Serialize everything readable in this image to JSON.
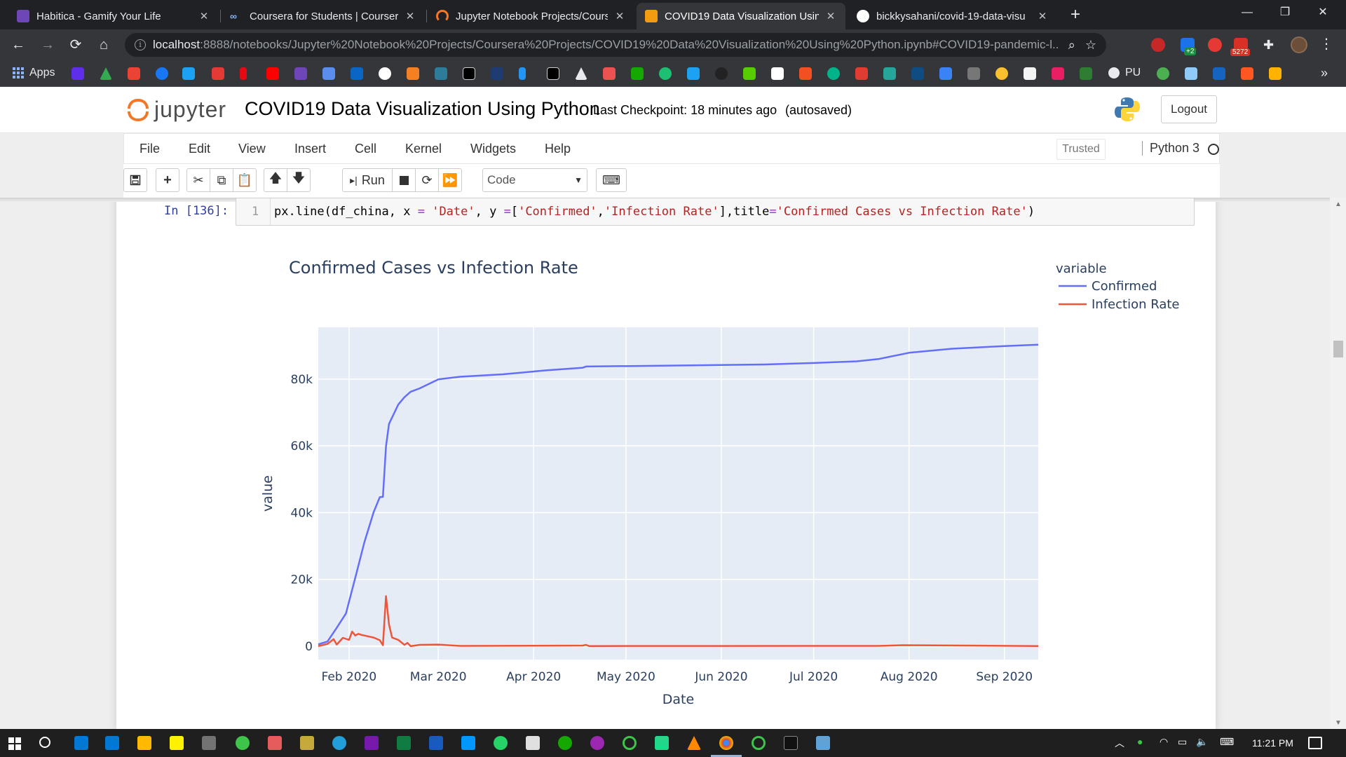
{
  "browser": {
    "tabs": [
      {
        "title": "Habitica - Gamify Your Life",
        "color": "#6f46b8"
      },
      {
        "title": "Coursera for Students | Coursera",
        "color": "#8ab4f8"
      },
      {
        "title": "Jupyter Notebook Projects/Cours",
        "color": "#f37726"
      },
      {
        "title": "COVID19 Data Visualization Usin",
        "color": "#f39c12"
      },
      {
        "title": "bickkysahani/covid-19-data-visu",
        "color": "#ffffff"
      }
    ],
    "active_tab_index": 3,
    "tab_close_glyph": "✕",
    "new_tab_glyph": "+",
    "window_controls": [
      "—",
      "❐",
      "✕"
    ],
    "url_host": "localhost",
    "url_rest": ":8888/notebooks/Jupyter%20Notebook%20Projects/Coursera%20Projects/COVID19%20Data%20Visualization%20Using%20Python.ipynb#COVID19-pandemic-l...",
    "extension_badges": {
      "plus": "+2",
      "count": "5272"
    },
    "bookmarks": {
      "apps_label": "Apps",
      "pu_label": "PU",
      "more": "»"
    }
  },
  "jupyter": {
    "logo_text": "jupyter",
    "notebook_title": "COVID19 Data Visualization Using Python",
    "checkpoint": "Last Checkpoint: 18 minutes ago",
    "autosave": "(autosaved)",
    "logout": "Logout",
    "menu": [
      "File",
      "Edit",
      "View",
      "Insert",
      "Cell",
      "Kernel",
      "Widgets",
      "Help"
    ],
    "trusted": "Trusted",
    "kernel": "Python 3",
    "toolbar": {
      "run_label": "Run",
      "cell_type": "Code"
    }
  },
  "cell": {
    "prompt": "In [136]:",
    "line_number": "1",
    "code_parts": [
      {
        "t": "px.line(df_china, x ",
        "c": "plain"
      },
      {
        "t": "=",
        "c": "op"
      },
      {
        "t": " ",
        "c": "plain"
      },
      {
        "t": "'Date'",
        "c": "str"
      },
      {
        "t": ", y ",
        "c": "plain"
      },
      {
        "t": "=",
        "c": "op"
      },
      {
        "t": "[",
        "c": "plain"
      },
      {
        "t": "'Confirmed'",
        "c": "str"
      },
      {
        "t": ",",
        "c": "plain"
      },
      {
        "t": "'Infection Rate'",
        "c": "str"
      },
      {
        "t": "],title",
        "c": "plain"
      },
      {
        "t": "=",
        "c": "op"
      },
      {
        "t": "'Confirmed Cases vs Infection Rate'",
        "c": "str"
      },
      {
        "t": ")",
        "c": "plain"
      }
    ]
  },
  "chart_data": {
    "type": "line",
    "title": "Confirmed Cases vs Infection Rate",
    "xlabel": "Date",
    "ylabel": "value",
    "x_tick_labels": [
      "Feb 2020",
      "Mar 2020",
      "Apr 2020",
      "May 2020",
      "Jun 2020",
      "Jul 2020",
      "Aug 2020",
      "Sep 2020"
    ],
    "x_tick_dates": [
      "2020-02-01",
      "2020-03-01",
      "2020-04-01",
      "2020-05-01",
      "2020-06-01",
      "2020-07-01",
      "2020-08-01",
      "2020-09-01"
    ],
    "xlim": [
      "2020-01-22",
      "2020-09-12"
    ],
    "y_ticks": [
      0,
      20000,
      40000,
      60000,
      80000
    ],
    "y_tick_labels": [
      "0",
      "20k",
      "40k",
      "60k",
      "80k"
    ],
    "ylim": [
      -4000,
      95500
    ],
    "grid": true,
    "legend_title": "variable",
    "legend_position": "top-right",
    "background_color": "#e5ecf6",
    "series": [
      {
        "name": "Confirmed",
        "color": "#636efa",
        "points": [
          [
            "2020-01-22",
            548
          ],
          [
            "2020-01-25",
            1406
          ],
          [
            "2020-01-28",
            5509
          ],
          [
            "2020-01-31",
            9802
          ],
          [
            "2020-02-03",
            20438
          ],
          [
            "2020-02-06",
            31161
          ],
          [
            "2020-02-09",
            40171
          ],
          [
            "2020-02-11",
            44653
          ],
          [
            "2020-02-12",
            44730
          ],
          [
            "2020-02-13",
            59882
          ],
          [
            "2020-02-14",
            66576
          ],
          [
            "2020-02-17",
            72364
          ],
          [
            "2020-02-19",
            74576
          ],
          [
            "2020-02-21",
            76208
          ],
          [
            "2020-02-24",
            77241
          ],
          [
            "2020-03-01",
            79932
          ],
          [
            "2020-03-08",
            80699
          ],
          [
            "2020-03-22",
            81435
          ],
          [
            "2020-04-05",
            82602
          ],
          [
            "2020-04-17",
            83403
          ],
          [
            "2020-04-18",
            83760
          ],
          [
            "2020-05-15",
            84038
          ],
          [
            "2020-06-15",
            84378
          ],
          [
            "2020-07-01",
            84816
          ],
          [
            "2020-07-15",
            85314
          ],
          [
            "2020-07-22",
            86000
          ],
          [
            "2020-08-01",
            87880
          ],
          [
            "2020-08-15",
            89100
          ],
          [
            "2020-09-01",
            89900
          ],
          [
            "2020-09-12",
            90300
          ]
        ]
      },
      {
        "name": "Infection Rate",
        "color": "#ef553b",
        "points": [
          [
            "2020-01-22",
            0
          ],
          [
            "2020-01-25",
            700
          ],
          [
            "2020-01-27",
            2100
          ],
          [
            "2020-01-28",
            500
          ],
          [
            "2020-01-30",
            2500
          ],
          [
            "2020-02-01",
            1900
          ],
          [
            "2020-02-02",
            4400
          ],
          [
            "2020-02-03",
            3200
          ],
          [
            "2020-02-04",
            3700
          ],
          [
            "2020-02-05",
            3400
          ],
          [
            "2020-02-07",
            3000
          ],
          [
            "2020-02-09",
            2600
          ],
          [
            "2020-02-11",
            1800
          ],
          [
            "2020-02-12",
            300
          ],
          [
            "2020-02-13",
            15000
          ],
          [
            "2020-02-14",
            6500
          ],
          [
            "2020-02-15",
            2600
          ],
          [
            "2020-02-17",
            1900
          ],
          [
            "2020-02-19",
            400
          ],
          [
            "2020-02-20",
            1000
          ],
          [
            "2020-02-21",
            0
          ],
          [
            "2020-02-24",
            400
          ],
          [
            "2020-03-01",
            500
          ],
          [
            "2020-03-08",
            100
          ],
          [
            "2020-04-17",
            200
          ],
          [
            "2020-04-18",
            400
          ],
          [
            "2020-04-19",
            50
          ],
          [
            "2020-07-22",
            100
          ],
          [
            "2020-07-30",
            300
          ],
          [
            "2020-09-12",
            50
          ]
        ]
      }
    ]
  },
  "taskbar": {
    "clock": "11:21 PM"
  }
}
